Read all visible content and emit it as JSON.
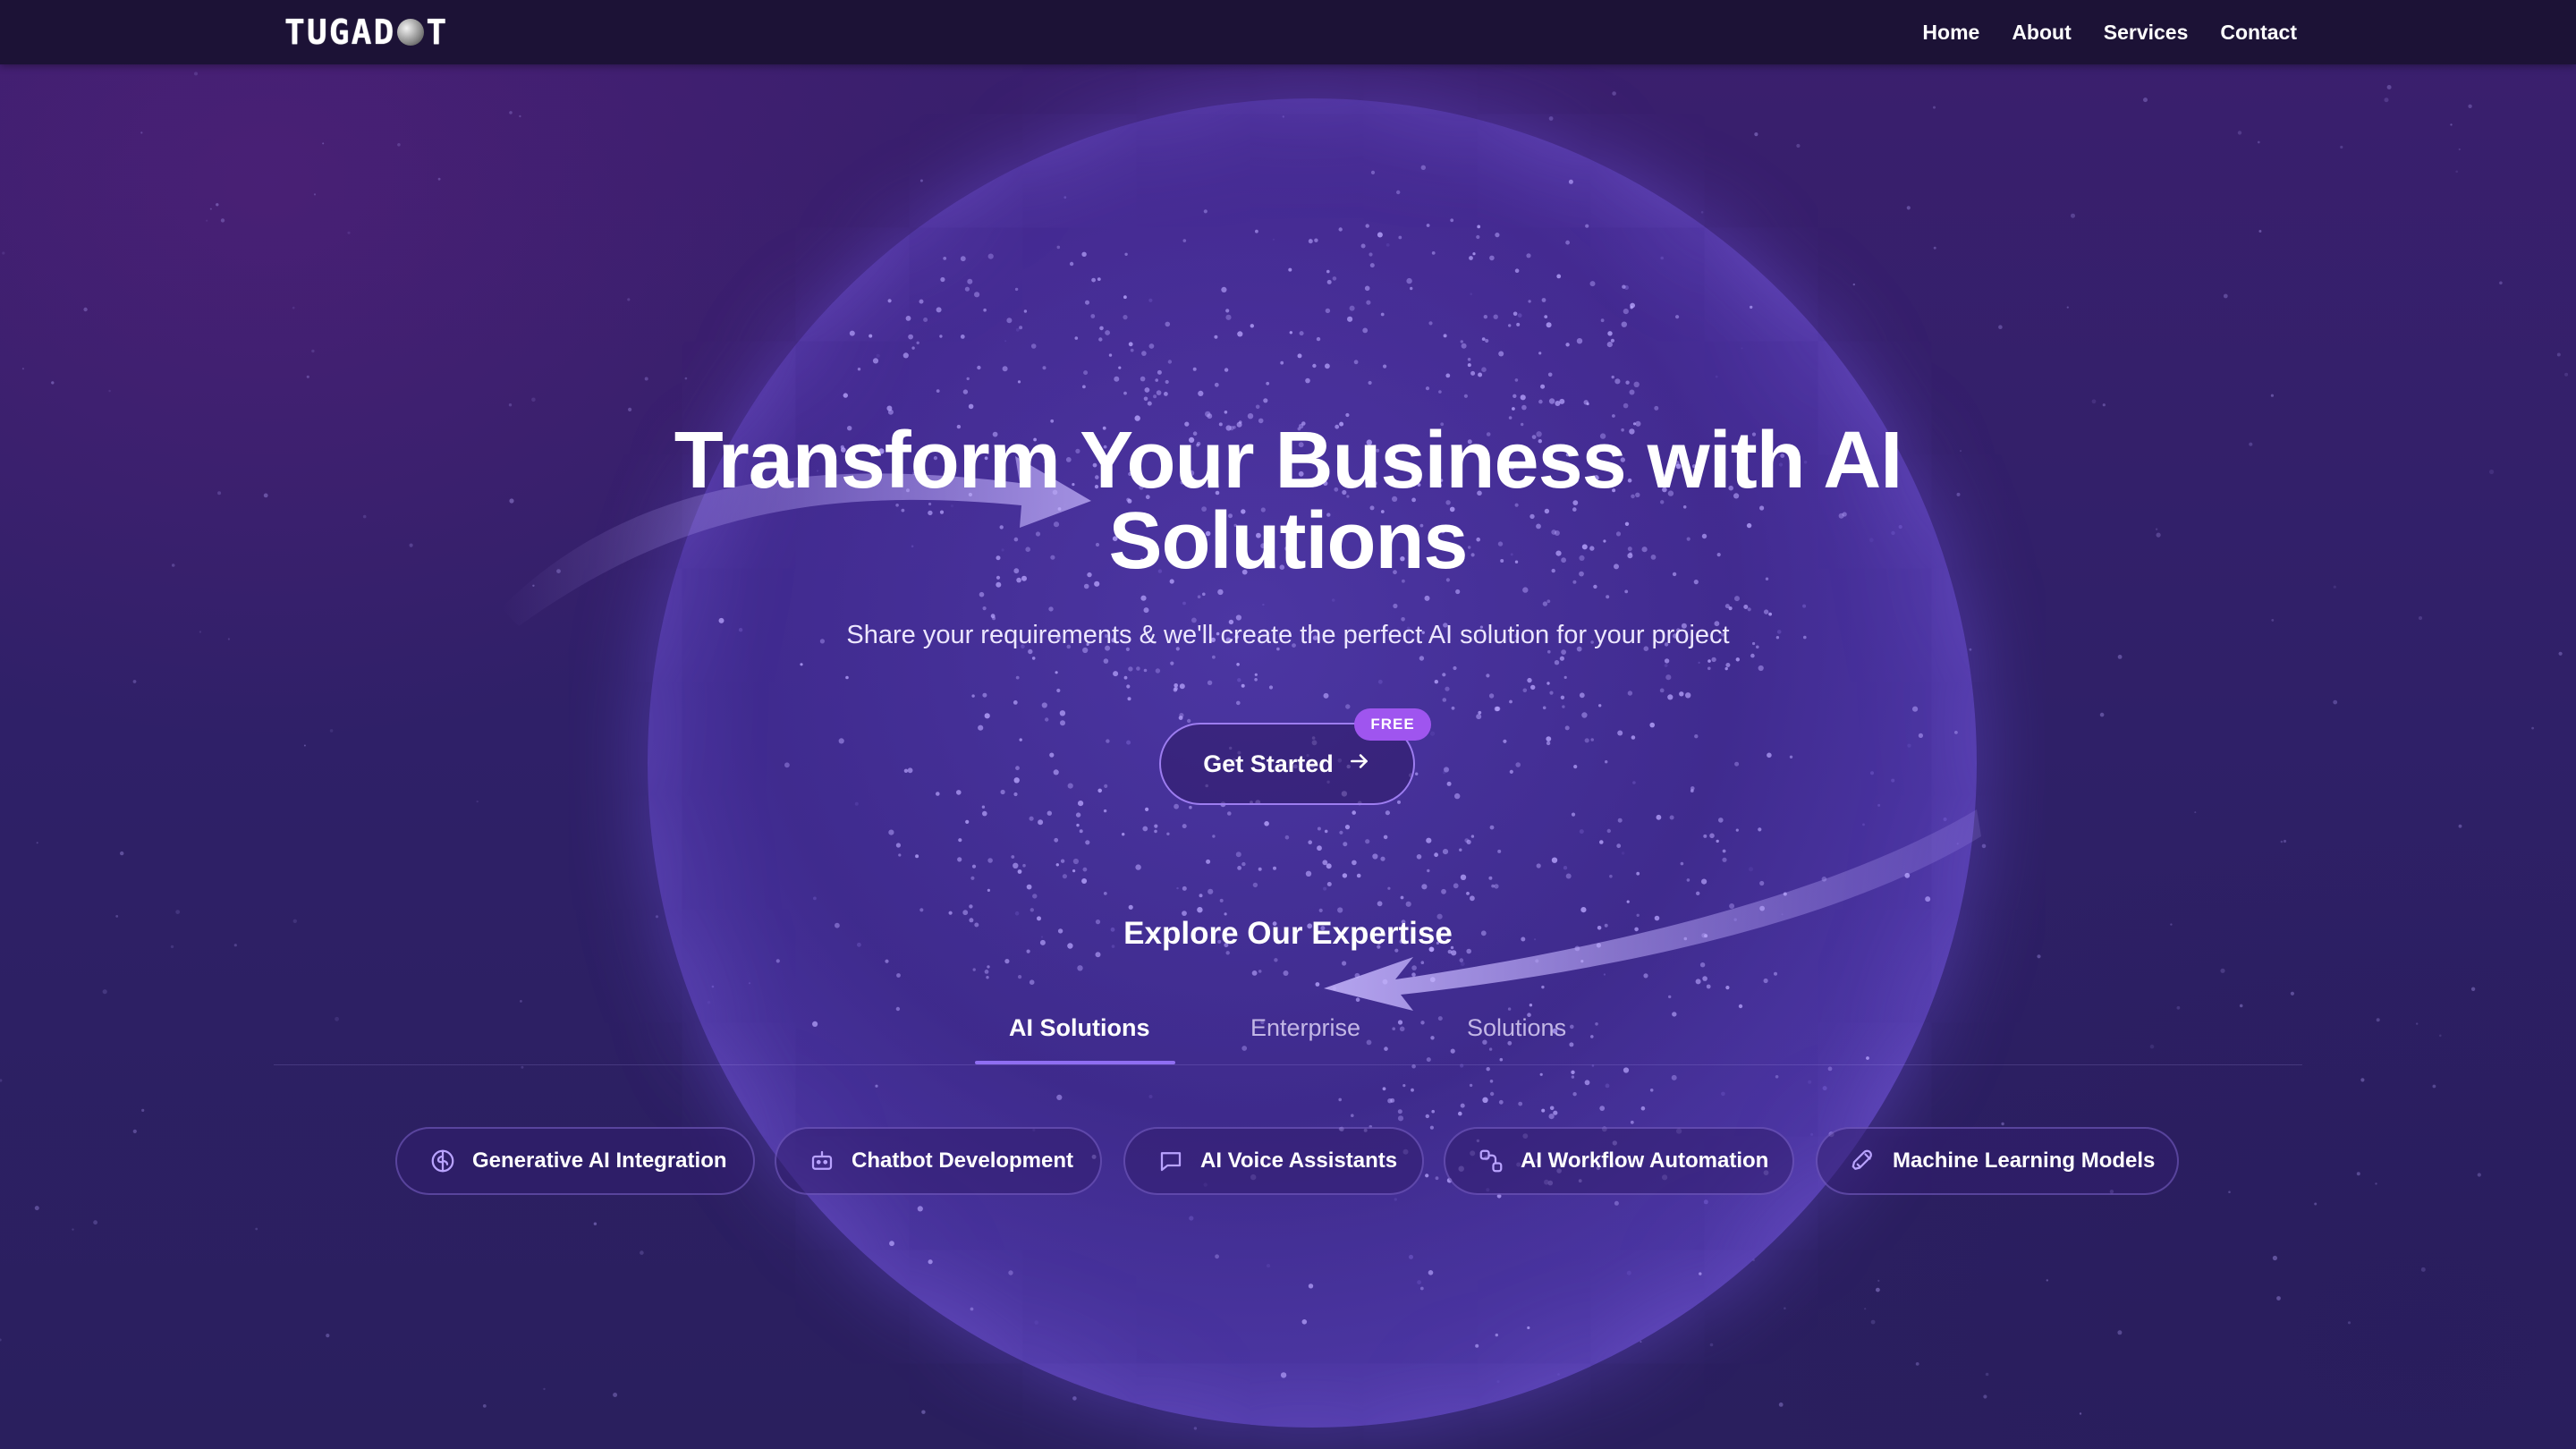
{
  "brand": {
    "logo_left": "TUGAD",
    "logo_right": "T"
  },
  "nav": {
    "items": [
      "Home",
      "About",
      "Services",
      "Contact"
    ]
  },
  "hero": {
    "title_line1": "Transform Your Business with AI",
    "title_line2": "Solutions",
    "subtitle": "Share your requirements & we'll create the perfect AI solution for your project",
    "cta_label": "Get Started",
    "cta_badge": "FREE"
  },
  "expertise": {
    "heading": "Explore Our Expertise",
    "tabs": [
      "AI Solutions",
      "Enterprise",
      "Solutions"
    ],
    "active_tab": "AI Solutions",
    "chips": [
      {
        "label": "Generative AI Integration",
        "icon": "brain-icon"
      },
      {
        "label": "Chatbot Development",
        "icon": "bot-icon"
      },
      {
        "label": "AI Voice Assistants",
        "icon": "chat-bubble-icon"
      },
      {
        "label": "AI Workflow Automation",
        "icon": "workflow-icon"
      },
      {
        "label": "Machine Learning Models",
        "icon": "rocket-icon"
      }
    ]
  },
  "colors": {
    "navbar": "#1c1236",
    "background": "#2e1d62",
    "accent": "#8f6ef2",
    "badge": "#9f55ef"
  }
}
